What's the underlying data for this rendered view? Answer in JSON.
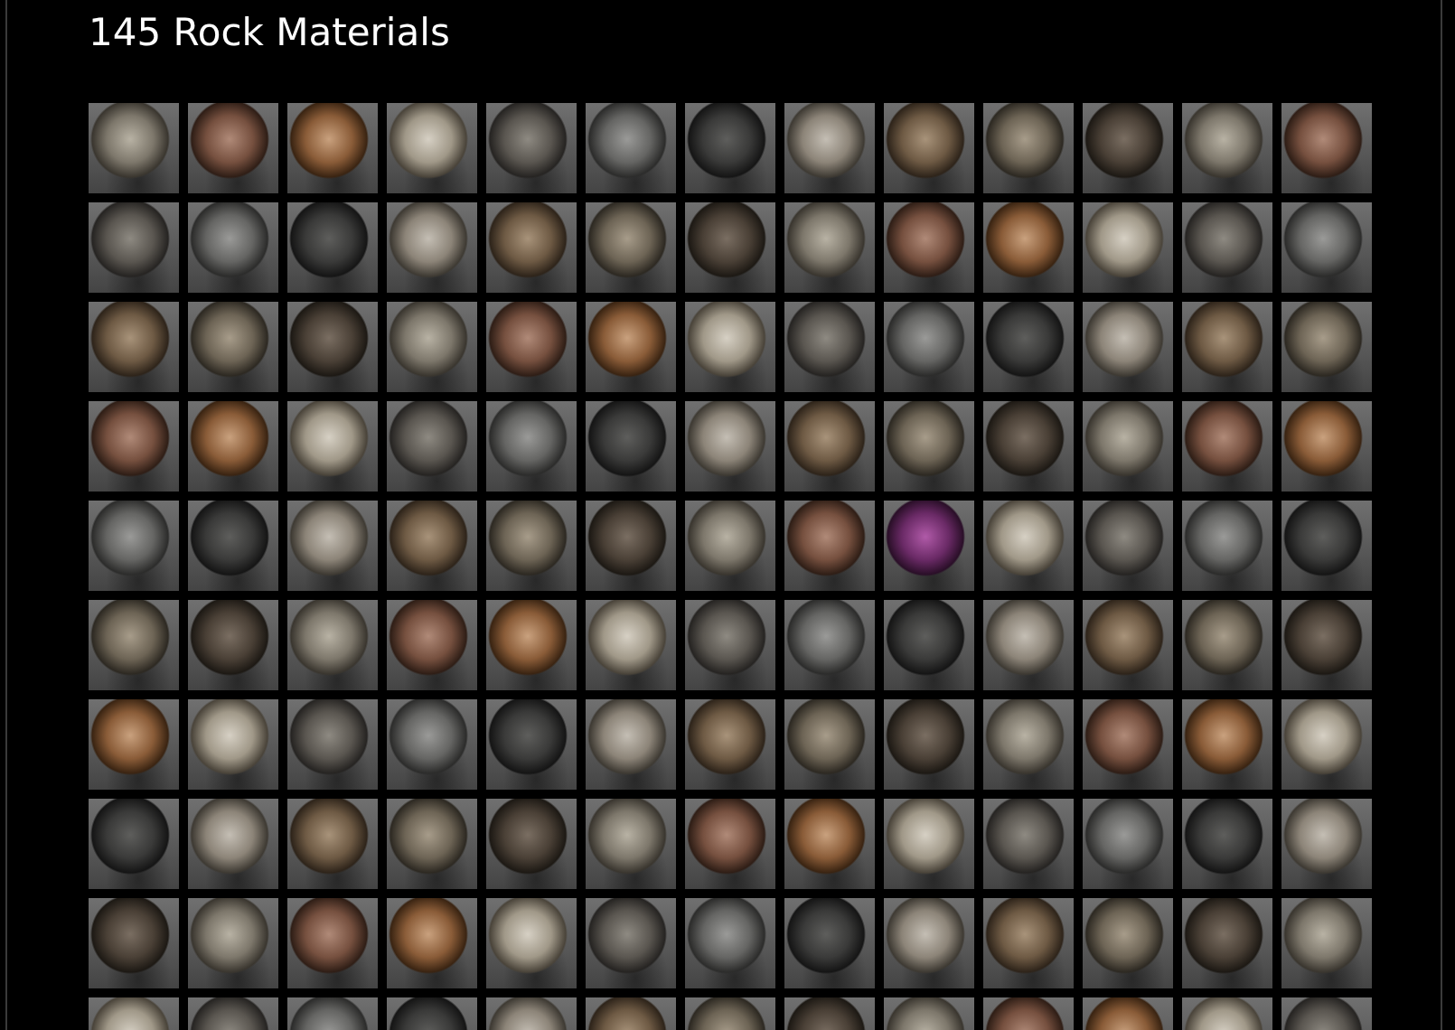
{
  "title": "145 Rock Materials"
}
